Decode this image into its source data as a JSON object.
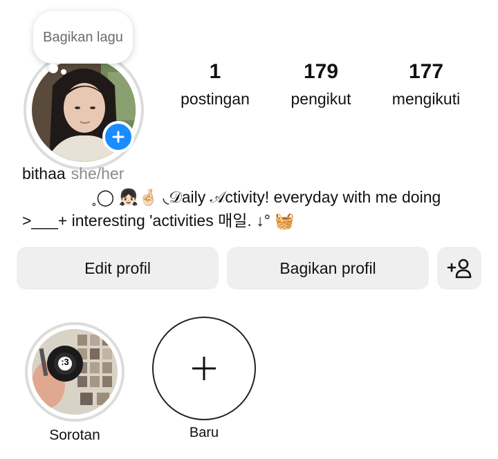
{
  "bubble": {
    "text": "Bagikan lagu"
  },
  "stats": [
    {
      "value": "1",
      "label": "postingan"
    },
    {
      "value": "179",
      "label": "pengikut"
    },
    {
      "value": "177",
      "label": "mengikuti"
    }
  ],
  "profile": {
    "username": "bithaa",
    "pronouns": "she/her",
    "bio_line1": "˳◯ 👧🏻🤞🏻 ◟𝒟aily 𝒜ctivity! everyday with me doing",
    "bio_line2": ">___+ interesting 'activities 매일. ↓° 🧺"
  },
  "buttons": {
    "edit": "Edit profil",
    "share": "Bagikan profil"
  },
  "highlights": [
    {
      "label": "Sorotan",
      "badge": ":3"
    },
    {
      "label": "Baru"
    }
  ],
  "colors": {
    "accent": "#1a8cff",
    "button_bg": "#efefef",
    "muted": "#8a8a8a"
  }
}
